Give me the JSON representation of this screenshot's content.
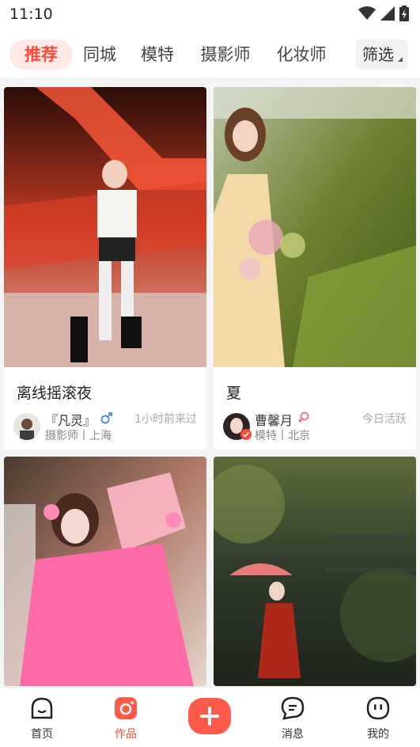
{
  "status_bar": {
    "time": "11:10"
  },
  "tabs": [
    {
      "label": "推荐",
      "active": true
    },
    {
      "label": "同城",
      "active": false
    },
    {
      "label": "模特",
      "active": false
    },
    {
      "label": "摄影师",
      "active": false
    },
    {
      "label": "化妆师",
      "active": false
    }
  ],
  "filter": {
    "label": "筛选"
  },
  "cards": [
    {
      "title": "离线摇滚夜",
      "user_name": "『凡灵』",
      "gender_icon": "male-icon",
      "role": "摄影师丨上海",
      "active_time": "1小时前来过"
    },
    {
      "title": "夏",
      "user_name": "曹馨月",
      "gender_icon": "female-icon",
      "role": "模特丨北京",
      "active_time": "今日活跃"
    },
    {
      "title": "",
      "user_name": "",
      "role": "",
      "active_time": ""
    },
    {
      "title": "",
      "user_name": "",
      "role": "",
      "active_time": ""
    }
  ],
  "nav": [
    {
      "label": "首页",
      "icon": "home-face-icon",
      "active": false
    },
    {
      "label": "作品",
      "icon": "camera-icon",
      "active": true
    },
    {
      "label": "",
      "icon": "plus-icon",
      "active": false
    },
    {
      "label": "消息",
      "icon": "chat-bubble-icon",
      "active": false
    },
    {
      "label": "我的",
      "icon": "profile-face-icon",
      "active": false
    }
  ],
  "colors": {
    "accent": "#ff4b3a",
    "accent_bg": "#ffe9e6"
  }
}
